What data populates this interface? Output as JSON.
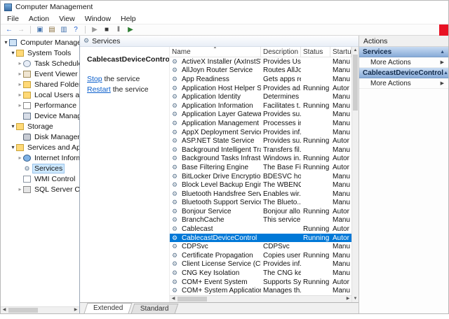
{
  "window": {
    "title": "Computer Management"
  },
  "menu": {
    "items": [
      "File",
      "Action",
      "View",
      "Window",
      "Help"
    ]
  },
  "toolbar": {
    "items": [
      {
        "name": "back-button",
        "glyph": "←",
        "color": "#1f5fd0"
      },
      {
        "name": "forward-button",
        "glyph": "→",
        "color": "#b8b8b8"
      },
      {
        "sep": true
      },
      {
        "name": "show-console-tree-button",
        "glyph": "▣",
        "color": "#4a78b0"
      },
      {
        "name": "properties-button",
        "glyph": "▤",
        "color": "#8a7040"
      },
      {
        "name": "export-list-button",
        "glyph": "▥",
        "color": "#4a78b0"
      },
      {
        "name": "help-button",
        "glyph": "?",
        "color": "#1f5fd0"
      },
      {
        "sep": true
      },
      {
        "name": "start-service-button",
        "glyph": "▶",
        "color": "#9a9a9a"
      },
      {
        "name": "stop-service-button",
        "glyph": "■",
        "color": "#333333"
      },
      {
        "name": "pause-service-button",
        "glyph": "‖",
        "color": "#333333"
      },
      {
        "name": "restart-service-button",
        "glyph": "▶",
        "color": "#2e7d32"
      }
    ]
  },
  "icons": {
    "expanded": "▾",
    "collapsed": "▸",
    "gear": "⚙",
    "sort": "▲",
    "collapse": "▲",
    "more": "▶",
    "up": "▲",
    "down": "▼",
    "left": "◀",
    "right": "▶"
  },
  "tree": {
    "items": [
      {
        "label": "Computer Management (Local",
        "depth": 0,
        "expander": "expanded",
        "icon": "computer"
      },
      {
        "label": "System Tools",
        "depth": 1,
        "expander": "expanded",
        "icon": "folder"
      },
      {
        "label": "Task Scheduler",
        "depth": 2,
        "expander": "collapsed",
        "icon": "clock"
      },
      {
        "label": "Event Viewer",
        "depth": 2,
        "expander": "collapsed",
        "icon": "log"
      },
      {
        "label": "Shared Folders",
        "depth": 2,
        "expander": "collapsed",
        "icon": "shared-folder"
      },
      {
        "label": "Local Users and Groups",
        "depth": 2,
        "expander": "collapsed",
        "icon": "users-folder"
      },
      {
        "label": "Performance",
        "depth": 2,
        "expander": "collapsed",
        "icon": "chart"
      },
      {
        "label": "Device Manager",
        "depth": 2,
        "expander": "none",
        "icon": "device"
      },
      {
        "label": "Storage",
        "depth": 1,
        "expander": "expanded",
        "icon": "folder"
      },
      {
        "label": "Disk Management",
        "depth": 2,
        "expander": "none",
        "icon": "disk"
      },
      {
        "label": "Services and Applications",
        "depth": 1,
        "expander": "expanded",
        "icon": "folder"
      },
      {
        "label": "Internet Information Ser",
        "depth": 2,
        "expander": "collapsed",
        "icon": "globe"
      },
      {
        "label": "Services",
        "depth": 2,
        "expander": "none",
        "icon": "gear",
        "selected": true
      },
      {
        "label": "WMI Control",
        "depth": 2,
        "expander": "none",
        "icon": "doc"
      },
      {
        "label": "SQL Server Configuratio",
        "depth": 2,
        "expander": "collapsed",
        "icon": "box"
      }
    ]
  },
  "services": {
    "caption": "Services",
    "selected_service": "CablecastDeviceControl",
    "task_links": [
      {
        "action": "Stop",
        "rest": " the service"
      },
      {
        "action": "Restart",
        "rest": " the service"
      }
    ],
    "columns": [
      "Name",
      "Description",
      "Status",
      "Startu"
    ],
    "rows": [
      {
        "name": "ActiveX Installer (AxInstSV)",
        "desc": "Provides Us...",
        "status": "",
        "startup": "Manu"
      },
      {
        "name": "AllJoyn Router Service",
        "desc": "Routes AllJo...",
        "status": "",
        "startup": "Manu"
      },
      {
        "name": "App Readiness",
        "desc": "Gets apps re...",
        "status": "",
        "startup": "Manu"
      },
      {
        "name": "Application Host Helper Ser...",
        "desc": "Provides ad...",
        "status": "Running",
        "startup": "Autor"
      },
      {
        "name": "Application Identity",
        "desc": "Determines ...",
        "status": "",
        "startup": "Manu"
      },
      {
        "name": "Application Information",
        "desc": "Facilitates t...",
        "status": "Running",
        "startup": "Manu"
      },
      {
        "name": "Application Layer Gateway ...",
        "desc": "Provides su...",
        "status": "",
        "startup": "Manu"
      },
      {
        "name": "Application Management",
        "desc": "Processes in...",
        "status": "",
        "startup": "Manu"
      },
      {
        "name": "AppX Deployment Service (...",
        "desc": "Provides inf...",
        "status": "",
        "startup": "Manu"
      },
      {
        "name": "ASP.NET State Service",
        "desc": "Provides su...",
        "status": "Running",
        "startup": "Autor"
      },
      {
        "name": "Background Intelligent Tran...",
        "desc": "Transfers fil...",
        "status": "",
        "startup": "Manu"
      },
      {
        "name": "Background Tasks Infrastru...",
        "desc": "Windows in...",
        "status": "Running",
        "startup": "Autor"
      },
      {
        "name": "Base Filtering Engine",
        "desc": "The Base Fil...",
        "status": "Running",
        "startup": "Autor"
      },
      {
        "name": "BitLocker Drive Encryption ...",
        "desc": "BDESVC hos...",
        "status": "",
        "startup": "Manu"
      },
      {
        "name": "Block Level Backup Engine ...",
        "desc": "The WBENG...",
        "status": "",
        "startup": "Manu"
      },
      {
        "name": "Bluetooth Handsfree Service",
        "desc": "Enables wir...",
        "status": "",
        "startup": "Manu"
      },
      {
        "name": "Bluetooth Support Service",
        "desc": "The Blueto...",
        "status": "",
        "startup": "Manu"
      },
      {
        "name": "Bonjour Service",
        "desc": "Bonjour allo...",
        "status": "Running",
        "startup": "Autor"
      },
      {
        "name": "BranchCache",
        "desc": "This service ...",
        "status": "",
        "startup": "Manu"
      },
      {
        "name": "Cablecast",
        "desc": "",
        "status": "Running",
        "startup": "Autor"
      },
      {
        "name": "CablecastDeviceControl",
        "desc": "",
        "status": "Running",
        "startup": "Autor",
        "selected": true
      },
      {
        "name": "CDPSvc",
        "desc": "CDPSvc",
        "status": "",
        "startup": "Manu"
      },
      {
        "name": "Certificate Propagation",
        "desc": "Copies user ...",
        "status": "Running",
        "startup": "Manu"
      },
      {
        "name": "Client License Service (ClipS...",
        "desc": "Provides inf...",
        "status": "",
        "startup": "Manu"
      },
      {
        "name": "CNG Key Isolation",
        "desc": "The CNG ke...",
        "status": "",
        "startup": "Manu"
      },
      {
        "name": "COM+ Event System",
        "desc": "Supports Sy...",
        "status": "Running",
        "startup": "Autor"
      },
      {
        "name": "COM+ System Application",
        "desc": "Manages th...",
        "status": "",
        "startup": "Manu"
      }
    ]
  },
  "tabs": [
    {
      "label": "Extended",
      "active": true
    },
    {
      "label": "Standard",
      "active": false
    }
  ],
  "actions": {
    "title": "Actions",
    "sections": [
      {
        "header": "Services",
        "items": [
          "More Actions"
        ]
      },
      {
        "header": "CablecastDeviceControl",
        "items": [
          "More Actions"
        ]
      }
    ]
  }
}
